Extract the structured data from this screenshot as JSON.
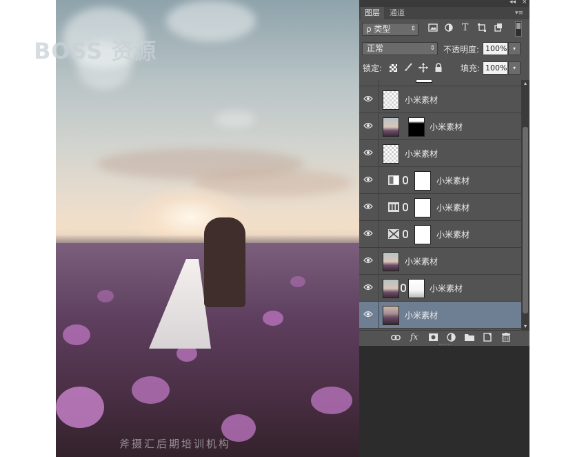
{
  "watermark": "BOSS 资源",
  "canvas_watermark": "斧摄汇后期培训机构",
  "panel": {
    "topbar": {
      "collapse": "◂◂",
      "close": "×",
      "menu": "▾≡"
    },
    "tabs": [
      {
        "label": "图层",
        "active": true
      },
      {
        "label": "通道",
        "active": false
      }
    ],
    "filter": {
      "label": "ρ 类型",
      "arrow": "⇕"
    },
    "filter_icons": [
      "image-icon",
      "adjustment-icon",
      "type-icon",
      "shape-icon",
      "smart-object-icon"
    ],
    "blend_mode": {
      "value": "正常",
      "arrow": "⇕"
    },
    "opacity": {
      "label": "不透明度:",
      "value": "100%",
      "arrow": "▾"
    },
    "lock": {
      "label": "锁定:"
    },
    "fill": {
      "label": "填充:",
      "value": "100%",
      "arrow": "▾"
    },
    "layers": [
      {
        "name": "小米素材",
        "thumb": "checker",
        "mask": null,
        "adj": null,
        "selected": false
      },
      {
        "name": "小米素材",
        "thumb": "photo",
        "mask": "mask-black",
        "adj": null,
        "selected": false
      },
      {
        "name": "小米素材",
        "thumb": "checker",
        "mask": null,
        "adj": null,
        "selected": false
      },
      {
        "name": "小米素材",
        "thumb": null,
        "mask": "white",
        "adj": "levels-icon",
        "selected": false
      },
      {
        "name": "小米素材",
        "thumb": null,
        "mask": "white",
        "adj": "curves-icon",
        "selected": false
      },
      {
        "name": "小米素材",
        "thumb": null,
        "mask": "white",
        "adj": "gradient-map-icon",
        "selected": false
      },
      {
        "name": "小米素材",
        "thumb": "photo",
        "mask": null,
        "adj": null,
        "selected": false
      },
      {
        "name": "小米素材",
        "thumb": "photo",
        "mask": "mask-soft",
        "adj": null,
        "selected": false
      },
      {
        "name": "小米素材",
        "thumb": "photo-dark",
        "mask": null,
        "adj": null,
        "selected": true
      }
    ],
    "footer_icons": [
      "link-layers-icon",
      "fx-icon",
      "add-mask-icon",
      "new-adjustment-icon",
      "new-group-icon",
      "new-layer-icon",
      "trash-icon"
    ],
    "footer_fx": "fx",
    "scroll_up": "▴",
    "scroll_down": "▾"
  }
}
